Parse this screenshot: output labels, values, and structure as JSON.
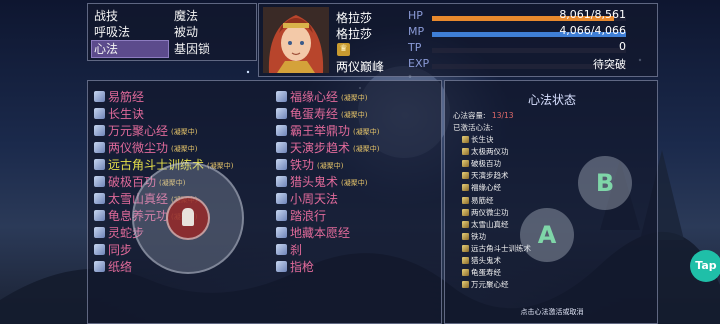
{
  "menu": {
    "left": [
      {
        "label": "战技",
        "selected": false
      },
      {
        "label": "呼吸法",
        "selected": false
      },
      {
        "label": "心法",
        "selected": true
      }
    ],
    "right": [
      {
        "label": "魔法"
      },
      {
        "label": "被动"
      },
      {
        "label": "基因锁"
      }
    ]
  },
  "character": {
    "name1": "格拉莎",
    "name2": "格拉莎",
    "class_icon": "crown-icon",
    "title": "两仪巅峰"
  },
  "stats": [
    {
      "label": "HP",
      "value": "8,061/8,561",
      "fill": 0.94,
      "color": "#e8892d"
    },
    {
      "label": "MP",
      "value": "4,066/4,066",
      "fill": 1.0,
      "color": "#3f7fd6"
    },
    {
      "label": "TP",
      "value": "0",
      "fill": 0.0,
      "color": "#888888"
    },
    {
      "label": "EXP",
      "value": "待突破",
      "fill": 0.0,
      "color": "#888888"
    }
  ],
  "skills_col1": [
    {
      "name": "易筋经",
      "color": "#e06a9a",
      "tag": ""
    },
    {
      "name": "长生诀",
      "color": "#e06a9a",
      "tag": ""
    },
    {
      "name": "万元聚心经",
      "color": "#e06a9a",
      "tag": "(凝聚中)"
    },
    {
      "name": "两仪微尘功",
      "color": "#e06a9a",
      "tag": "(凝聚中)"
    },
    {
      "name": "远古角斗士训练术",
      "color": "#e6e04a",
      "tag": "(凝聚中)"
    },
    {
      "name": "破极百功",
      "color": "#e06a9a",
      "tag": "(凝聚中)"
    },
    {
      "name": "太雪山真经",
      "color": "#e06a9a",
      "tag": "(凝聚中)"
    },
    {
      "name": "龟息养元功",
      "color": "#e06a9a",
      "tag": "(凝聚中)"
    },
    {
      "name": "灵蛇步",
      "color": "#e06a9a",
      "tag": ""
    },
    {
      "name": "同步",
      "color": "#e06a9a",
      "tag": ""
    },
    {
      "name": "纸络",
      "color": "#e06a9a",
      "tag": ""
    }
  ],
  "skills_col2": [
    {
      "name": "福缘心经",
      "color": "#e06a9a",
      "tag": "(凝聚中)"
    },
    {
      "name": "龟蛋寿经",
      "color": "#e06a9a",
      "tag": "(凝聚中)"
    },
    {
      "name": "霸王举鼎功",
      "color": "#e06a9a",
      "tag": "(凝聚中)"
    },
    {
      "name": "天演步趋术",
      "color": "#e06a9a",
      "tag": "(凝聚中)"
    },
    {
      "name": "铁功",
      "color": "#e06a9a",
      "tag": "(凝聚中)"
    },
    {
      "name": "猎头鬼术",
      "color": "#e06a9a",
      "tag": "(凝聚中)"
    },
    {
      "name": "小周天法",
      "color": "#e06a9a",
      "tag": ""
    },
    {
      "name": "踏浪行",
      "color": "#e06a9a",
      "tag": ""
    },
    {
      "name": "地藏本愿经",
      "color": "#e06a9a",
      "tag": ""
    },
    {
      "name": "刹",
      "color": "#e06a9a",
      "tag": ""
    },
    {
      "name": "指枪",
      "color": "#e06a9a",
      "tag": ""
    }
  ],
  "status_panel": {
    "title": "心法状态",
    "capacity_label": "心法容量:",
    "capacity_value": "13/13",
    "active_label": "已激活心法:",
    "active_items": [
      "长生诀",
      "太极两仪功",
      "破极百功",
      "天演步趋术",
      "福缘心经",
      "易筋经",
      "两仪微尘功",
      "太雪山真经",
      "铁功",
      "远古角斗士训练术",
      "猎头鬼术",
      "龟蛋寿经",
      "万元聚心经"
    ],
    "footer": "点击心法激活或取消"
  },
  "buttons": {
    "a": "A",
    "b": "B"
  },
  "tap_badge": "Tap"
}
